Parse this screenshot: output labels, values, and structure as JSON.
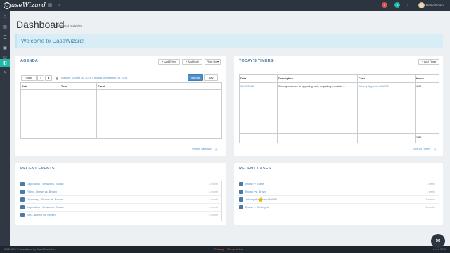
{
  "app": {
    "logo_text": "aseWizard",
    "logo_initial": "C",
    "user_name": "DemoBrown",
    "notifications": [
      {
        "count": "1",
        "color": "#d9534f"
      },
      {
        "count": "1",
        "color": "#22b8a6"
      },
      {
        "count": "1",
        "color": "#7a8590"
      }
    ]
  },
  "page": {
    "title": "Dashboard",
    "subtitle": "events and activities"
  },
  "welcome": {
    "text": "Welcome to CaseWizard!"
  },
  "agenda": {
    "title": "AGENDA",
    "add_event": "+ Add Event",
    "add_note": "+ Add Note",
    "filter_by": "Filter By",
    "today": "Today",
    "date_range": "Tuesday, August 30, 2016 Tuesday, September 06, 2016",
    "view_agenda": "Agenda",
    "view_day": "Day",
    "columns": [
      "Date",
      "Time",
      "Event"
    ],
    "footer_link": "View in calendar"
  },
  "timers": {
    "title": "TODAY'S TIMERS",
    "add_timer": "+ Add Timer",
    "columns": [
      "Date",
      "Description",
      "Case",
      "Hours"
    ],
    "rows": [
      {
        "date": "08/30/2016",
        "description": "Correspondence to opposing party regarding medical ...",
        "case": "Johnny Appleseed/HARD",
        "hours": "1.00"
      }
    ],
    "total": "1.00",
    "footer_link": "See All Timers"
  },
  "recent_events": {
    "title": "RECENT EVENTS",
    "items": [
      {
        "label": "Deposition - Brown vs. Brown",
        "meta": "a month"
      },
      {
        "label": "Filing - Brown vs. Brown",
        "meta": "a month"
      },
      {
        "label": "Discovery - Brown vs. Brown",
        "meta": "a month"
      },
      {
        "label": "Deposition - Brown vs. Brown",
        "meta": "a month"
      },
      {
        "label": "IME - Brown vs. Brown",
        "meta": "a month"
      }
    ]
  },
  "recent_cases": {
    "title": "RECENT CASES",
    "items": [
      {
        "label": "Brown v. Travis",
        "meta": "1 week"
      },
      {
        "label": "Brown vs. Brown",
        "meta": "1 week"
      },
      {
        "label": "Johnny Appleseed/HARD",
        "meta": "3 weeks"
      },
      {
        "label": "Brown v. DeAngelo",
        "meta": "1 month"
      }
    ]
  },
  "footer": {
    "copyright": "2005-2016 © CaseWizard by CaseWizard, Inc.",
    "privacy": "Privacy",
    "terms": "Terms of Use",
    "version": "v4.0.0.2016"
  }
}
